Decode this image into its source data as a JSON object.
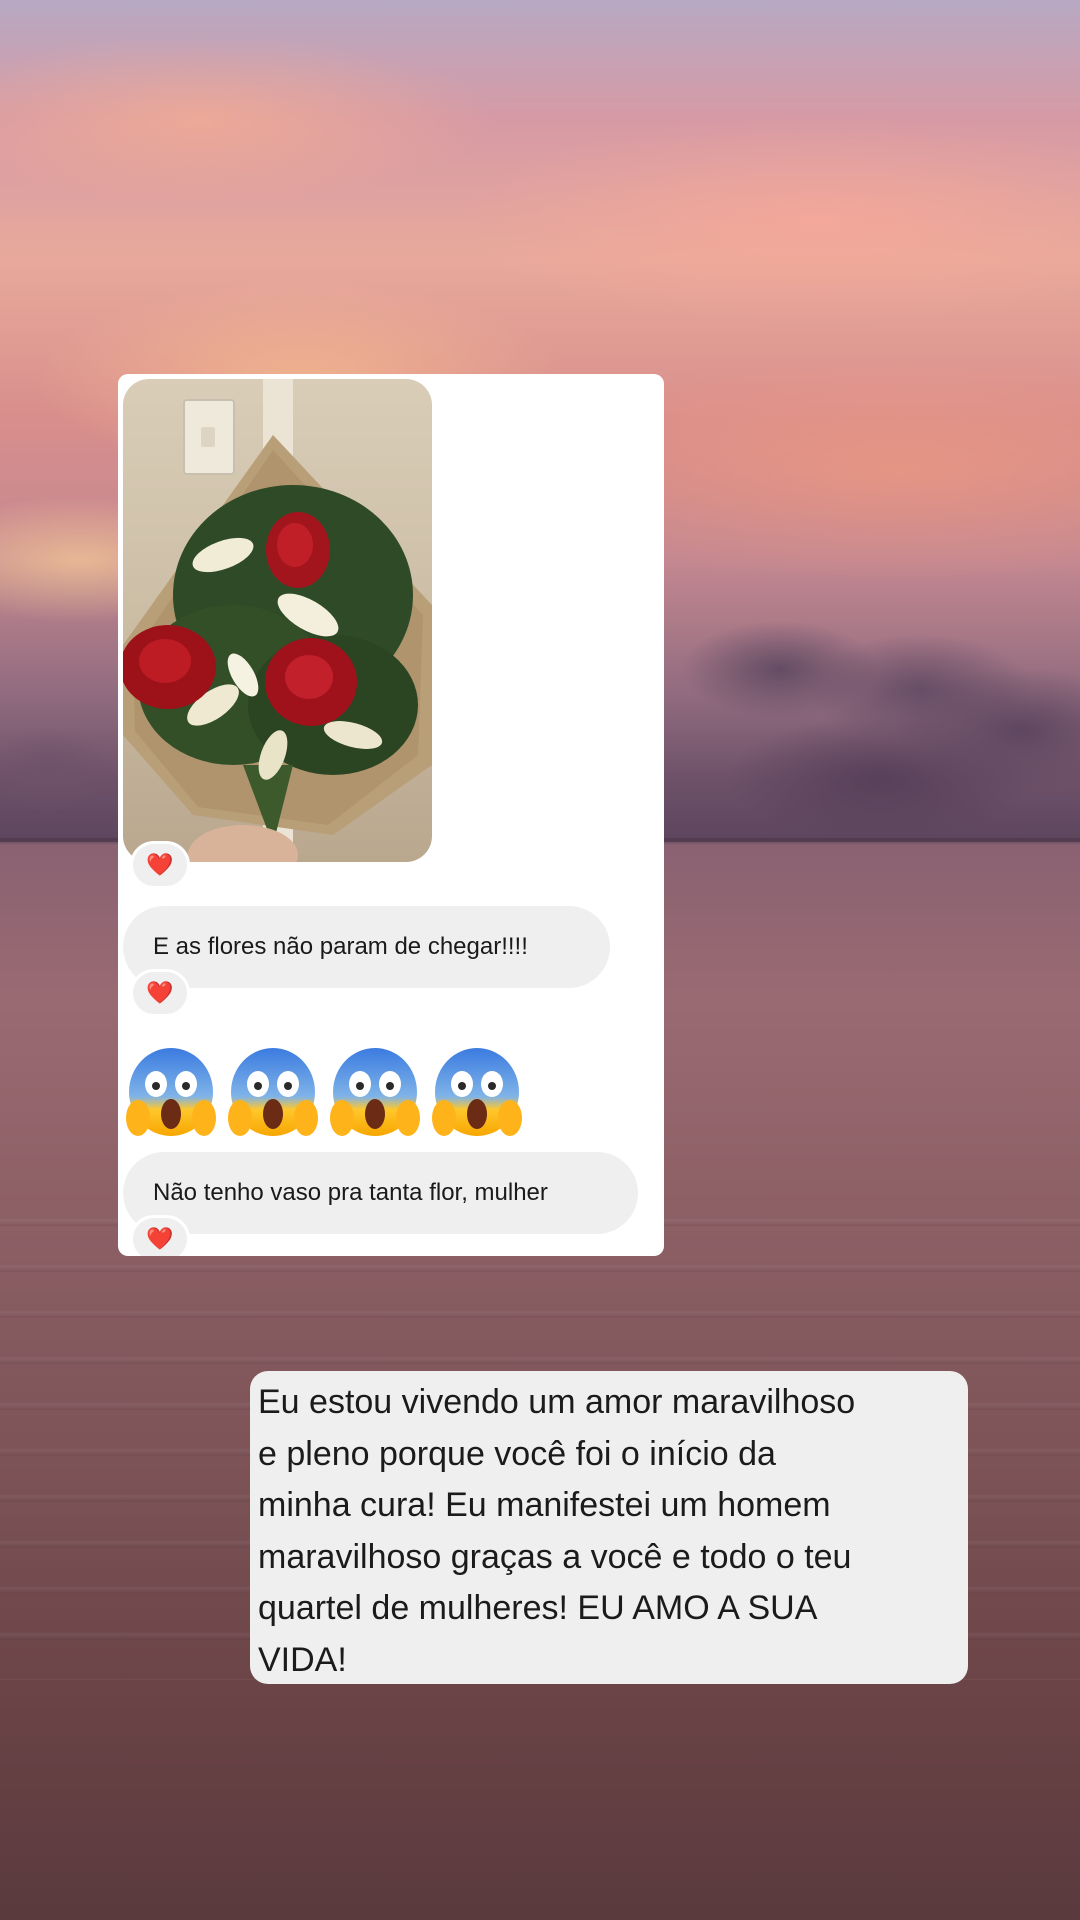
{
  "messages": [
    {
      "type": "image",
      "description_icon": "bouquet-photo",
      "reaction": "❤️"
    },
    {
      "type": "text",
      "text": "E as flores não param de chegar!!!!",
      "reaction": "❤️"
    },
    {
      "type": "emoji",
      "emojis": [
        "😱",
        "😱",
        "😱",
        "😱"
      ]
    },
    {
      "type": "text",
      "text": "Não tenho vaso pra tanta flor, mulher",
      "reaction": "❤️"
    }
  ],
  "caption": {
    "text": "Eu estou vivendo um amor maravilhoso\ne pleno porque você foi o início da\nminha cura! Eu manifestei um homem\nmaravilhoso graças a você e todo o teu\nquartel de mulheres! EU AMO A SUA\nVIDA!"
  },
  "colors": {
    "bubble": "#efefef",
    "heart": "#e0262f",
    "card": "#ffffff"
  }
}
